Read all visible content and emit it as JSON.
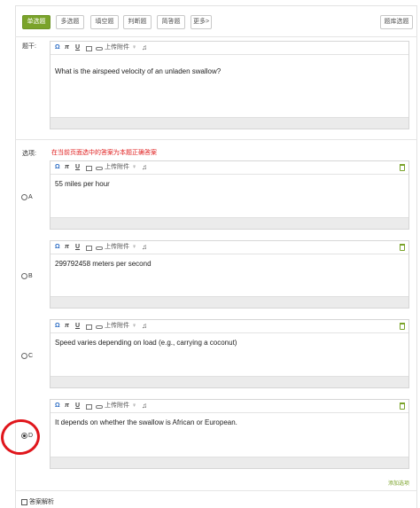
{
  "question_types": {
    "single": "单选题",
    "multiple": "多选题",
    "fill": "填空题",
    "judge": "判断题",
    "short": "简答题",
    "more": "更多>",
    "bank": "题库选题"
  },
  "stem": {
    "label": "题干:",
    "text": "What is the airspeed velocity of an unladen swallow?"
  },
  "editor_toolbar": {
    "omega": "Ω",
    "pi": "π",
    "underline": "U",
    "upload": "上传附件",
    "mic": "♀",
    "music": "♫"
  },
  "options": {
    "label": "选项:",
    "hint": "在当前页面选中的答案为本题正确答案",
    "items": [
      {
        "letter": "A",
        "text": "55 miles per hour",
        "selected": false
      },
      {
        "letter": "B",
        "text": "299792458 meters per second",
        "selected": false
      },
      {
        "letter": "C",
        "text": "Speed varies depending on load (e.g., carrying a coconut)",
        "selected": false
      },
      {
        "letter": "D",
        "text": "It depends on whether the swallow is African or European.",
        "selected": true
      }
    ],
    "add_option": "添加选项"
  },
  "analysis": {
    "label": "答案解析",
    "checked": false
  },
  "colors": {
    "accent": "#7aa32a",
    "hint_red": "#e02020",
    "circle_annotation": "#e0161c"
  }
}
